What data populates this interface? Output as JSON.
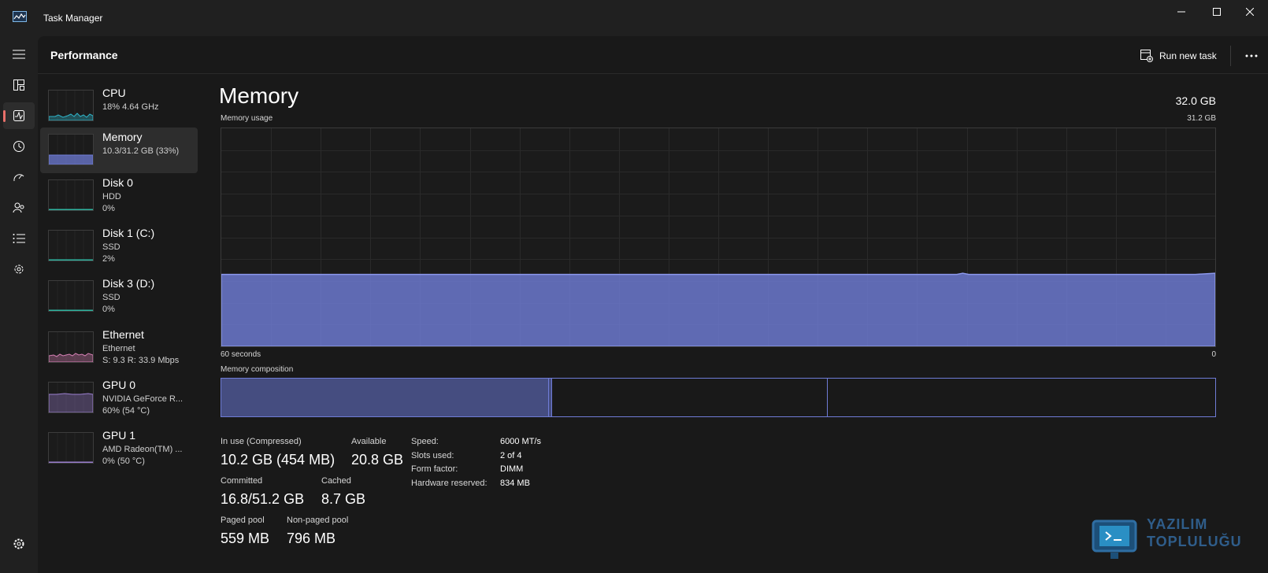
{
  "window": {
    "title": "Task Manager"
  },
  "header": {
    "page_title": "Performance",
    "run_task_label": "Run new task"
  },
  "rail": {
    "items": [
      "menu-icon",
      "processes-icon",
      "performance-icon",
      "app-history-icon",
      "startup-apps-icon",
      "users-icon",
      "details-icon",
      "services-icon"
    ],
    "active": "performance-icon",
    "settings": "settings-icon"
  },
  "devices": [
    {
      "name": "CPU",
      "line2": "18%  4.64 GHz",
      "line3": "",
      "color": "#2fb4c8"
    },
    {
      "name": "Memory",
      "line2": "10.3/31.2 GB (33%)",
      "line3": "",
      "color": "#6f7cd6"
    },
    {
      "name": "Disk 0",
      "line2": "HDD",
      "line3": "0%",
      "color": "#2fb4a0"
    },
    {
      "name": "Disk 1 (C:)",
      "line2": "SSD",
      "line3": "2%",
      "color": "#2fb4a0"
    },
    {
      "name": "Disk 3 (D:)",
      "line2": "SSD",
      "line3": "0%",
      "color": "#2fb4a0"
    },
    {
      "name": "Ethernet",
      "line2": "Ethernet",
      "line3": "S: 9.3  R: 33.9 Mbps",
      "color": "#d47fb3"
    },
    {
      "name": "GPU 0",
      "line2": "NVIDIA GeForce R...",
      "line3": "60%  (54 °C)",
      "color": "#9b7fcf"
    },
    {
      "name": "GPU 1",
      "line2": "AMD Radeon(TM) ...",
      "line3": "0%  (50 °C)",
      "color": "#9b7fcf"
    }
  ],
  "detail": {
    "title": "Memory",
    "total": "32.0 GB",
    "usage_label": "Memory usage",
    "usage_max": "31.2 GB",
    "axis_left": "60 seconds",
    "axis_right": "0",
    "composition_label": "Memory composition",
    "usage_fraction": 0.33,
    "composition": {
      "in_use_fraction": 0.33,
      "modified_fraction": 0.003,
      "standby_fraction": 0.277
    },
    "stats": {
      "in_use_label": "In use (Compressed)",
      "in_use_value": "10.2 GB (454 MB)",
      "available_label": "Available",
      "available_value": "20.8 GB",
      "committed_label": "Committed",
      "committed_value": "16.8/51.2 GB",
      "cached_label": "Cached",
      "cached_value": "8.7 GB",
      "paged_label": "Paged pool",
      "paged_value": "559 MB",
      "nonpaged_label": "Non-paged pool",
      "nonpaged_value": "796 MB"
    },
    "specs": [
      {
        "label": "Speed:",
        "value": "6000 MT/s"
      },
      {
        "label": "Slots used:",
        "value": "2 of 4"
      },
      {
        "label": "Form factor:",
        "value": "DIMM"
      },
      {
        "label": "Hardware reserved:",
        "value": "834 MB"
      }
    ]
  },
  "watermark": {
    "line1": "YAZILIM",
    "line2": "TOPLULUĞU"
  }
}
